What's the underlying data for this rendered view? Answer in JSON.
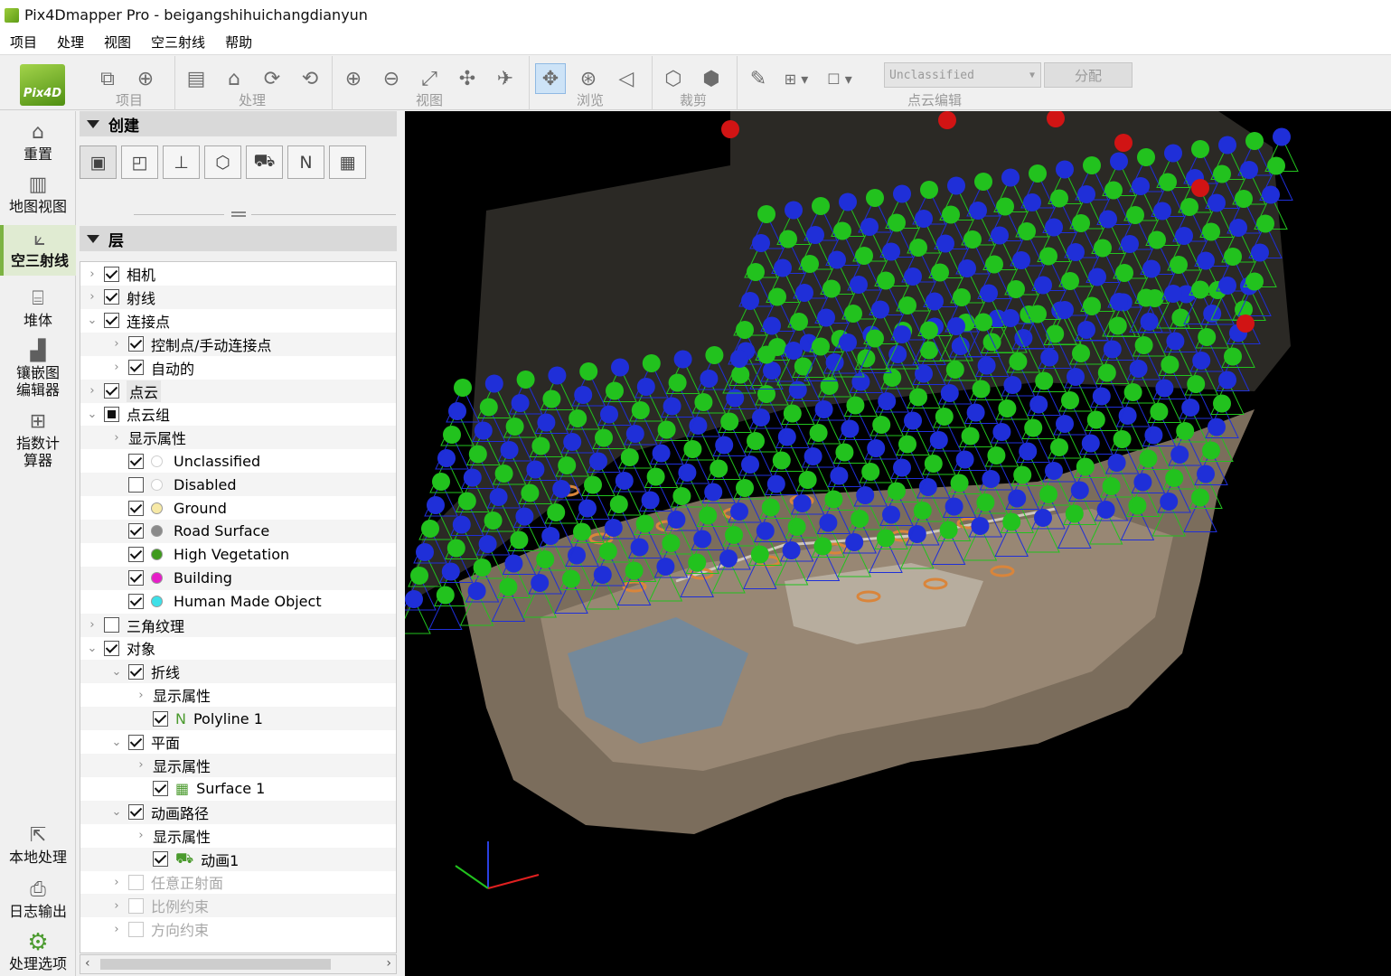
{
  "window": {
    "title": "Pix4Dmapper Pro - beigangshihuichangdianyun"
  },
  "menu": [
    "项目",
    "处理",
    "视图",
    "空三射线",
    "帮助"
  ],
  "logo": {
    "text": "Pix4D"
  },
  "toolbar": {
    "groups": [
      {
        "label": "项目",
        "icons": [
          "camera-icon",
          "target-icon"
        ]
      },
      {
        "label": "处理",
        "icons": [
          "document-check-icon",
          "processing-icon",
          "refresh-icon",
          "refresh-alt-icon"
        ]
      },
      {
        "label": "视图",
        "icons": [
          "zoom-in-icon",
          "zoom-out-icon",
          "fit-view-icon",
          "collapse-icon",
          "airplane-icon"
        ]
      },
      {
        "label": "浏览",
        "icons": [
          "pan-icon",
          "orbit-icon",
          "fly-icon"
        ]
      },
      {
        "label": "裁剪",
        "icons": [
          "box-icon",
          "box-alt-icon"
        ]
      },
      {
        "label": "点云编辑",
        "icons": [
          "brush-icon",
          "add-icon",
          "color-box-icon"
        ]
      }
    ],
    "class_select": "Unclassified",
    "assign_label": "分配"
  },
  "sidebar": {
    "items": [
      {
        "label": "重置",
        "icon": "home-icon"
      },
      {
        "label": "地图视图",
        "icon": "map-icon"
      },
      {
        "label": "空三射线",
        "icon": "rays-icon",
        "active": true
      },
      {
        "label": "堆体",
        "icon": "volume-icon"
      },
      {
        "label": "镶嵌图编辑器",
        "icon": "mosaic-icon"
      },
      {
        "label": "指数计算器",
        "icon": "calculator-icon"
      },
      {
        "label": "本地处理",
        "icon": "export-icon"
      },
      {
        "label": "日志输出",
        "icon": "log-icon"
      },
      {
        "label": "处理选项",
        "icon": "gear-icon"
      }
    ]
  },
  "panel": {
    "create_title": "创建",
    "layers_title": "层",
    "tree": [
      {
        "indent": 0,
        "arrow": "›",
        "check": "on",
        "text": "相机"
      },
      {
        "indent": 0,
        "arrow": "›",
        "check": "on",
        "text": "射线"
      },
      {
        "indent": 0,
        "arrow": "⌄",
        "check": "on",
        "text": "连接点"
      },
      {
        "indent": 1,
        "arrow": "›",
        "check": "on",
        "text": "控制点/手动连接点"
      },
      {
        "indent": 1,
        "arrow": "›",
        "check": "on",
        "text": "自动的"
      },
      {
        "indent": 0,
        "arrow": "›",
        "check": "on",
        "text": "点云",
        "hl": true
      },
      {
        "indent": 0,
        "arrow": "⌄",
        "check": "part",
        "text": "点云组"
      },
      {
        "indent": 1,
        "arrow": "›",
        "check": "none",
        "text": "显示属性"
      },
      {
        "indent": 1,
        "arrow": "",
        "check": "on",
        "dot": "#ffffff",
        "text": "Unclassified"
      },
      {
        "indent": 1,
        "arrow": "",
        "check": "off",
        "dot": "#ffffff",
        "text": "Disabled"
      },
      {
        "indent": 1,
        "arrow": "",
        "check": "on",
        "dot": "#f7e9a6",
        "text": "Ground"
      },
      {
        "indent": 1,
        "arrow": "",
        "check": "on",
        "dot": "#8a8a8a",
        "text": "Road Surface"
      },
      {
        "indent": 1,
        "arrow": "",
        "check": "on",
        "dot": "#3f9a1e",
        "text": "High Vegetation"
      },
      {
        "indent": 1,
        "arrow": "",
        "check": "on",
        "dot": "#e61ec8",
        "text": "Building"
      },
      {
        "indent": 1,
        "arrow": "",
        "check": "on",
        "dot": "#3ee0e8",
        "text": "Human Made Object"
      },
      {
        "indent": 0,
        "arrow": "›",
        "check": "off",
        "text": "三角纹理"
      },
      {
        "indent": 0,
        "arrow": "⌄",
        "check": "on",
        "text": "对象"
      },
      {
        "indent": 1,
        "arrow": "⌄",
        "check": "on",
        "text": "折线"
      },
      {
        "indent": 2,
        "arrow": "›",
        "check": "none",
        "text": "显示属性"
      },
      {
        "indent": 2,
        "arrow": "",
        "check": "on",
        "icon": "polyline-icon",
        "glyph": "N",
        "text": "Polyline 1"
      },
      {
        "indent": 1,
        "arrow": "⌄",
        "check": "on",
        "text": "平面"
      },
      {
        "indent": 2,
        "arrow": "›",
        "check": "none",
        "text": "显示属性"
      },
      {
        "indent": 2,
        "arrow": "",
        "check": "on",
        "icon": "surface-icon",
        "glyph": "▦",
        "text": "Surface 1"
      },
      {
        "indent": 1,
        "arrow": "⌄",
        "check": "on",
        "text": "动画路径"
      },
      {
        "indent": 2,
        "arrow": "›",
        "check": "none",
        "text": "显示属性"
      },
      {
        "indent": 2,
        "arrow": "",
        "check": "on",
        "icon": "animation-icon",
        "glyph": "⛟",
        "text": "动画1"
      },
      {
        "indent": 1,
        "arrow": "›",
        "check": "dis",
        "text": "任意正射面",
        "disabled": true
      },
      {
        "indent": 1,
        "arrow": "›",
        "check": "dis",
        "text": "比例约束",
        "disabled": true
      },
      {
        "indent": 1,
        "arrow": "›",
        "check": "dis",
        "text": "方向约束",
        "disabled": true
      }
    ]
  },
  "colors": {
    "accent": "#7cb342",
    "camera_blue": "#1f2fd8",
    "camera_green": "#22c21e",
    "gcp_red": "#d11414",
    "object_orange": "#d9853b"
  }
}
